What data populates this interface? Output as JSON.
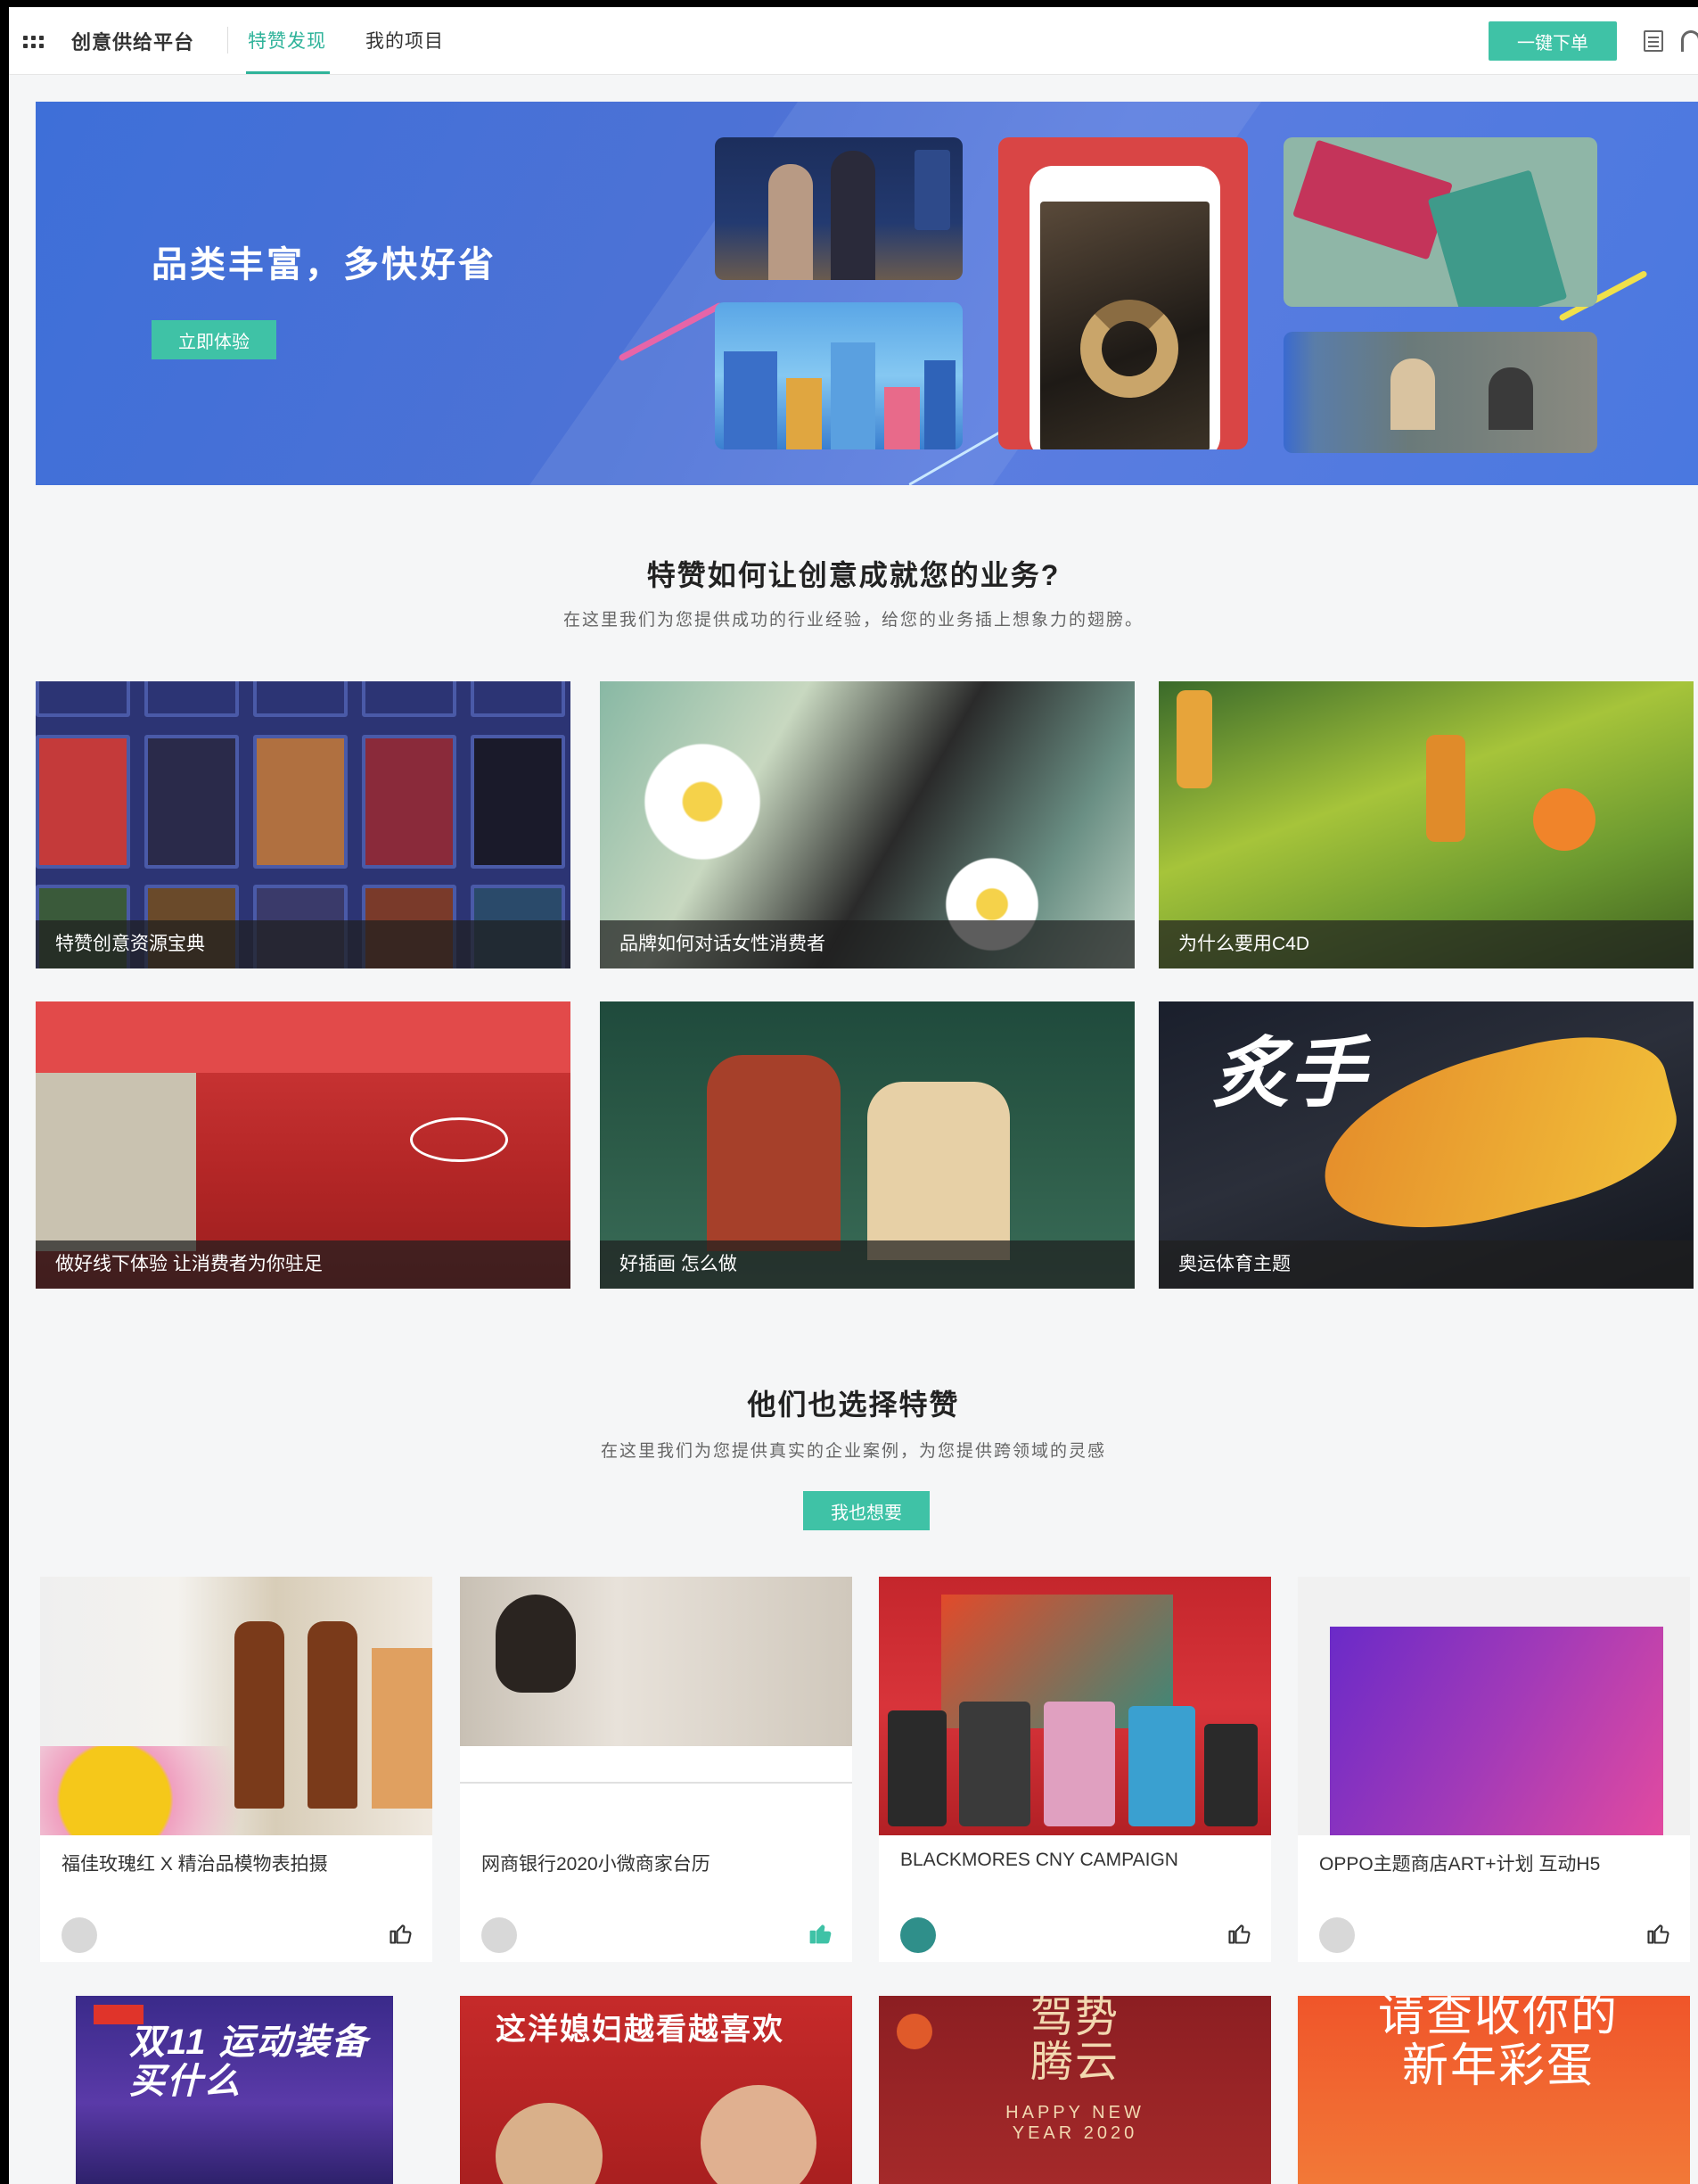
{
  "header": {
    "brand": "创意供给平台",
    "tabs": [
      {
        "label": "特赞发现",
        "active": true
      },
      {
        "label": "我的项目",
        "active": false
      }
    ],
    "order_button": "一键下单",
    "accent_color": "#2fb39a",
    "button_color": "#3fc2a6",
    "icons": [
      "apps-grid-icon",
      "document-icon",
      "headset-icon"
    ]
  },
  "banner": {
    "title": "品类丰富，多快好省",
    "button": "立即体验"
  },
  "guides_section": {
    "title": "特赞如何让创意成就您的业务?",
    "subtitle": "在这里我们为您提供成功的行业经验，给您的业务插上想象力的翅膀。",
    "cards": [
      {
        "label": "特赞创意资源宝典"
      },
      {
        "label": "品牌如何对话女性消费者"
      },
      {
        "label": "为什么要用C4D"
      },
      {
        "label": "做好线下体验 让消费者为你驻足"
      },
      {
        "label": "好插画 怎么做"
      },
      {
        "label": "奥运体育主题"
      }
    ]
  },
  "cases_section": {
    "title": "他们也选择特赞",
    "subtitle": "在这里我们为您提供真实的企业案例，为您提供跨领域的灵感",
    "button": "我也想要",
    "cards": [
      {
        "title": "福佳玫瑰红 X 精治品模物表拍摄",
        "liked": false
      },
      {
        "title": "网商银行2020小微商家台历",
        "liked": true
      },
      {
        "title": "BLACKMORES CNY CAMPAIGN",
        "liked": false
      },
      {
        "title": "OPPO主题商店ART+计划 互动H5",
        "liked": false
      }
    ],
    "lower_card_texts": {
      "card1": "双11 运动装备买什么",
      "card2": "这洋媳妇越看越喜欢",
      "card3_main": "驾势 腾云",
      "card3_sub": "HAPPY NEW YEAR 2020",
      "card4": "请查收你的 新年彩蛋"
    }
  }
}
